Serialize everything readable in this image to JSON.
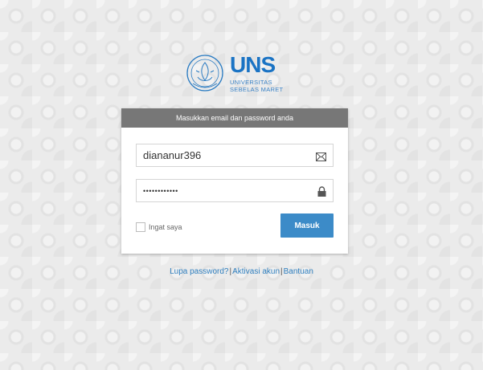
{
  "logo": {
    "name": "UNS",
    "line1": "UNIVERSITAS",
    "line2": "SEBELAS MARET",
    "color": "#1a73c4"
  },
  "form": {
    "header": "Masukkan email dan password anda",
    "email": {
      "value": "diananur396",
      "icon": "envelope-icon"
    },
    "password": {
      "value": "••••••••••••",
      "icon": "lock-icon"
    },
    "remember_label": "Ingat saya",
    "remember_checked": false,
    "submit_label": "Masuk",
    "accent": "#3c8bc8",
    "header_color": "#777777"
  },
  "links": {
    "forgot": "Lupa password?",
    "separator": "|",
    "activate": "Aktivasi akun",
    "help": "Bantuan"
  }
}
